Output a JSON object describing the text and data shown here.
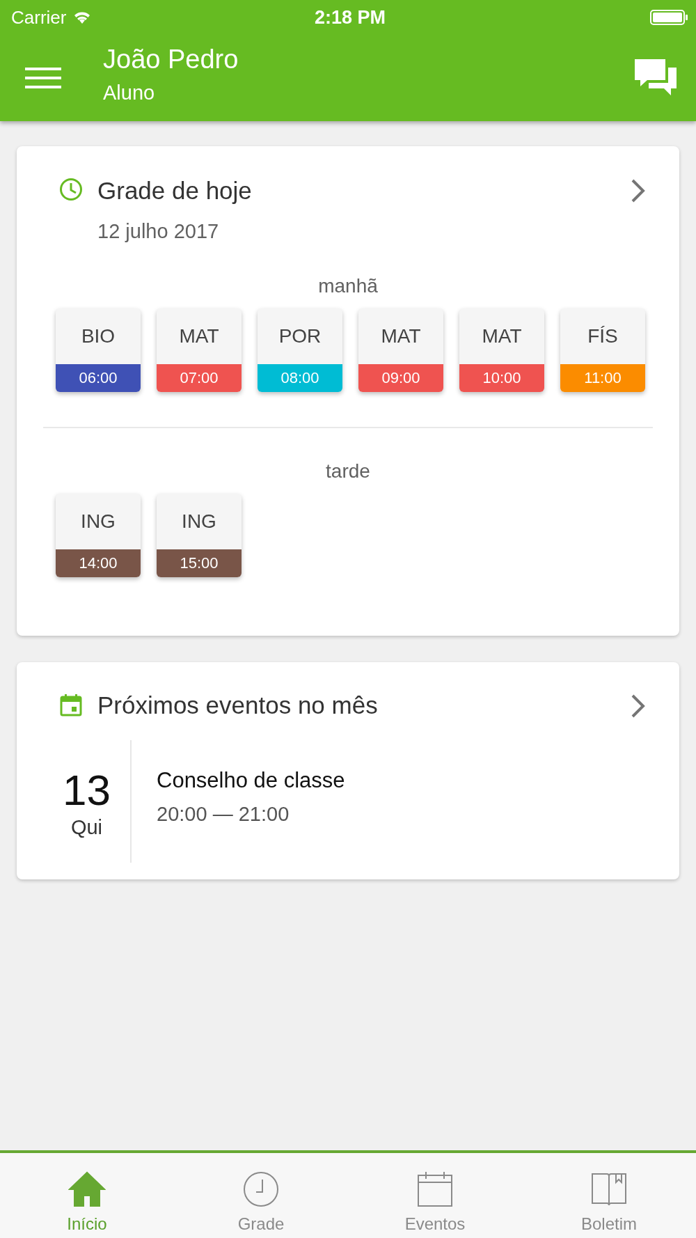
{
  "status_bar": {
    "carrier": "Carrier",
    "time": "2:18 PM"
  },
  "header": {
    "title": "João Pedro",
    "subtitle": "Aluno"
  },
  "schedule_card": {
    "title": "Grade de hoje",
    "date": "12 julho 2017",
    "periods": [
      {
        "label": "manhã",
        "classes": [
          {
            "subject": "BIO",
            "time": "06:00",
            "color": "#3f51b5"
          },
          {
            "subject": "MAT",
            "time": "07:00",
            "color": "#ef5350"
          },
          {
            "subject": "POR",
            "time": "08:00",
            "color": "#00bcd4"
          },
          {
            "subject": "MAT",
            "time": "09:00",
            "color": "#ef5350"
          },
          {
            "subject": "MAT",
            "time": "10:00",
            "color": "#ef5350"
          },
          {
            "subject": "FÍS",
            "time": "11:00",
            "color": "#fb8c00"
          }
        ]
      },
      {
        "label": "tarde",
        "classes": [
          {
            "subject": "ING",
            "time": "14:00",
            "color": "#795548"
          },
          {
            "subject": "ING",
            "time": "15:00",
            "color": "#795548"
          }
        ]
      }
    ]
  },
  "events_card": {
    "title": "Próximos eventos no mês",
    "events": [
      {
        "day": "13",
        "weekday": "Qui",
        "title": "Conselho de classe",
        "time": "20:00 — 21:00"
      }
    ]
  },
  "tabs": [
    {
      "label": "Início",
      "selected": true
    },
    {
      "label": "Grade",
      "selected": false
    },
    {
      "label": "Eventos",
      "selected": false
    },
    {
      "label": "Boletim",
      "selected": false
    }
  ]
}
